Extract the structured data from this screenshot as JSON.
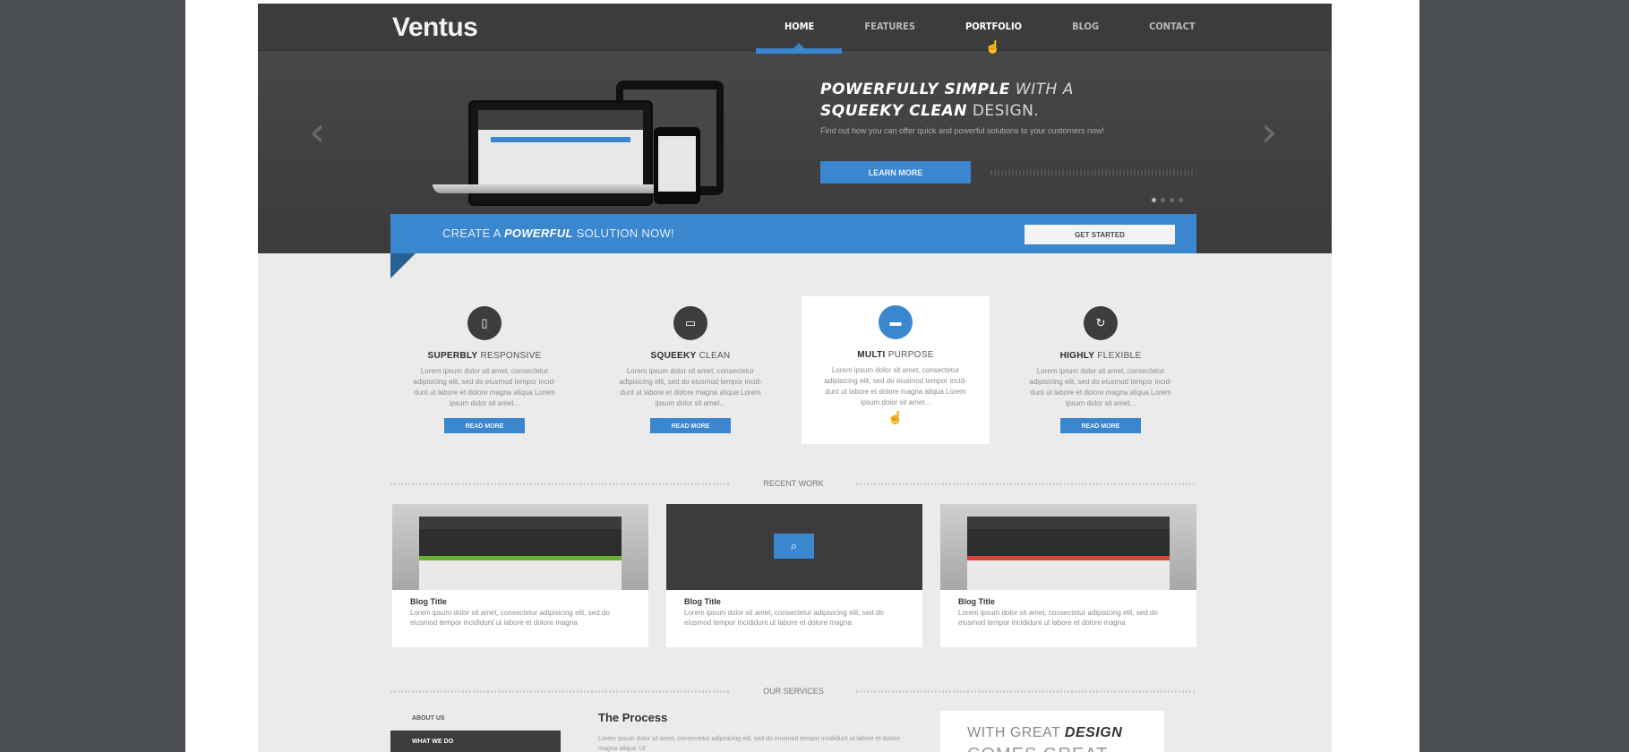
{
  "brand": {
    "name": "Ventus"
  },
  "nav": {
    "items": [
      "HOME",
      "FEATURES",
      "PORTFOLIO",
      "BLOG",
      "CONTACT"
    ],
    "active": "HOME"
  },
  "hero": {
    "title_l1_strong": "POWERFULLY SIMPLE",
    "title_l1_rest": " WITH A",
    "title_l2_strong": "SQUEEKY CLEAN",
    "title_l2_rest": " DESIGN.",
    "desc": "Find out how you can offer quick and powerful solutions to your customers now!",
    "button": "LEARN MORE",
    "prev_icon": "‹",
    "next_icon": "›"
  },
  "cta": {
    "pre": "CREATE A ",
    "strong": "POWERFUL",
    "post": " SOLUTION NOW!",
    "button": "GET STARTED"
  },
  "features": [
    {
      "strong": "SUPERBLY",
      "rest": " RESPONSIVE",
      "icon": "tablet-icon",
      "glyph": "▯",
      "desc": "Lorem ipsum dolor sit amet, consectetur adipisicing elit, sed do eiusmod tempor incid-dunt ut labore et dolore magna aliqua Lorem ipsum dolor sit amet...",
      "button": "READ MORE"
    },
    {
      "strong": "SQUEEKY",
      "rest": " CLEAN",
      "icon": "monitor-icon",
      "glyph": "▭",
      "desc": "Lorem ipsum dolor sit amet, consectetur adipisicing elit, sed do eiusmod tempor incid-dunt ut labore et dolore magna aliqua Lorem ipsum dolor sit amet...",
      "button": "READ MORE"
    },
    {
      "strong": "MULTI",
      "rest": " PURPOSE",
      "icon": "laptop-icon",
      "glyph": "▬",
      "desc": "Lorem ipsum dolor sit amet, consectetur adipisicing elit, sed do eiusmod tempor incid-dunt ut labore et dolore magna aliqua Lorem ipsum dolor sit amet..."
    },
    {
      "strong": "HIGHLY",
      "rest": " FLEXIBLE",
      "icon": "refresh-icon",
      "glyph": "↻",
      "desc": "Lorem ipsum dolor sit amet, consectetur adipisicing elit, sed do eiusmod tempor incid-dunt ut labore et dolore magna aliqua Lorem ipsum dolor sit amet...",
      "button": "READ MORE"
    }
  ],
  "recent_work": {
    "heading": "RECENT WORK",
    "items": [
      {
        "title": "Blog Title",
        "desc": "Lorem ipsum dolor sit amet, consectetur adipisicing elit, sed do eiusmod tempor incididunt ut labore et dolore magna"
      },
      {
        "title": "Blog Title",
        "desc": "Lorem ipsum dolor sit amet, consectetur adipisicing elit, sed do eiusmod tempor incididunt ut labore et dolore magna"
      },
      {
        "title": "Blog Title",
        "desc": "Lorem ipsum dolor sit amet, consectetur adipisicing elit, sed do eiusmod tempor incididunt ut labore et dolore magna"
      }
    ]
  },
  "services": {
    "heading": "OUR SERVICES",
    "menu": [
      "ABOUT US",
      "WHAT WE DO"
    ],
    "process_title": "The Process",
    "process_desc": "Lorem ipsum dolor sit amet, consectetur adipisicing elit, sed do eiusmod tempor incididunt ut labore et dolore magna aliqua. Ut",
    "quote_l1_pre": "WITH GREAT ",
    "quote_l1_strong": "DESIGN",
    "quote_l2": "COMES GREAT"
  },
  "colors": {
    "accent": "#3a86cf",
    "dark": "#3c3c3c",
    "outer": "#4b4e53",
    "teal": "#0f3e4d"
  }
}
